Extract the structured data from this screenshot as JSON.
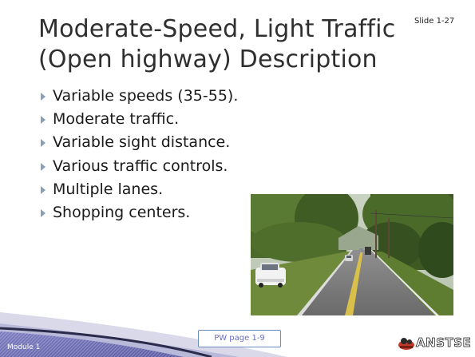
{
  "slide": {
    "number_label": "Slide 1-27",
    "title_lines": [
      "Moderate-Speed, Light Traffic",
      "(Open highway) Description"
    ],
    "bullets": [
      "Variable speeds (35-55).",
      "Moderate traffic.",
      "Variable sight distance.",
      "Various traffic controls.",
      "Multiple lanes.",
      "Shopping centers."
    ],
    "bullet_icon": "triangle-right-icon"
  },
  "footer": {
    "module_label": "Module 1",
    "pw_button_label": "PW page 1-9",
    "logo_text": "ANSTSE",
    "logo_icon": "driver-car-icon"
  },
  "colors": {
    "title": "#2f2f2f",
    "bullet_marker": "#8a9fb4",
    "footer_band_dark": "#6a6ab0",
    "footer_band_light": "#e4e4f0",
    "pw_button_border": "#6f8cc0",
    "pw_button_text": "#6a6fbf"
  }
}
